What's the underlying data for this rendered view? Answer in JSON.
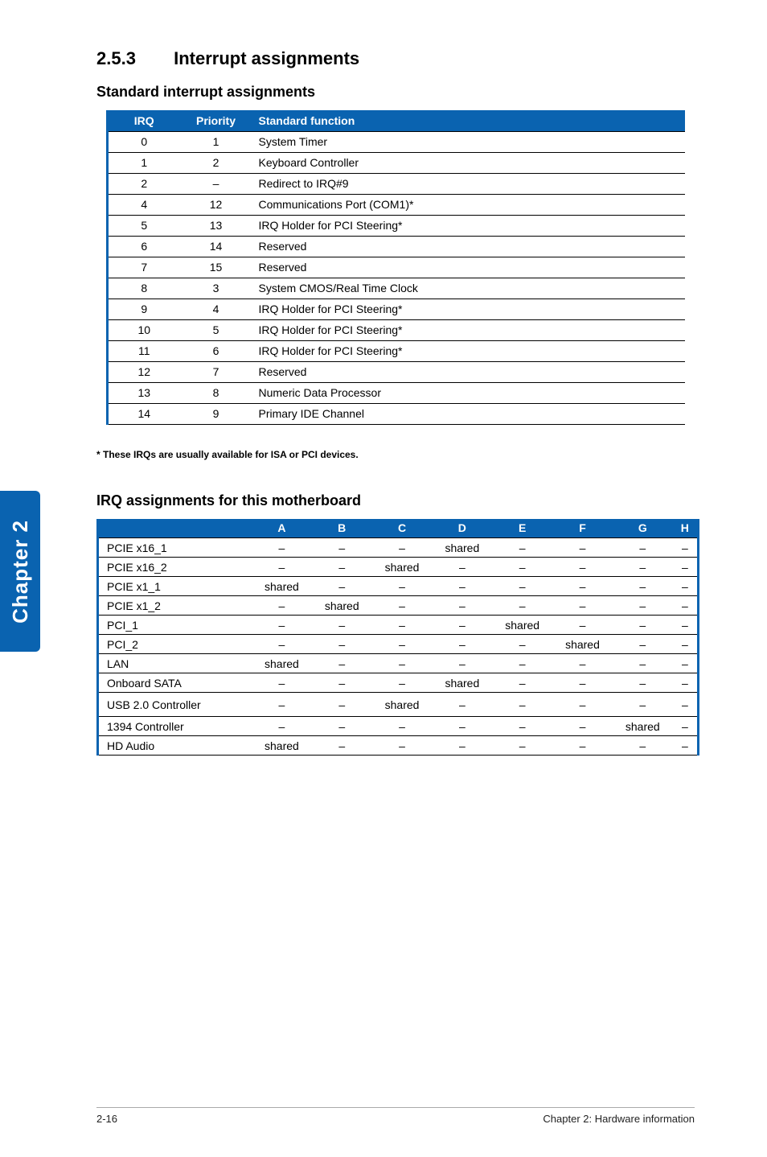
{
  "section": {
    "number": "2.5.3",
    "title": "Interrupt assignments"
  },
  "sub1": "Standard interrupt assignments",
  "table1": {
    "headers": [
      "IRQ",
      "Priority",
      "Standard function"
    ],
    "rows": [
      {
        "irq": "0",
        "pri": "1",
        "fn": "System Timer"
      },
      {
        "irq": "1",
        "pri": "2",
        "fn": "Keyboard Controller"
      },
      {
        "irq": "2",
        "pri": "–",
        "fn": "Redirect to IRQ#9"
      },
      {
        "irq": "4",
        "pri": "12",
        "fn": "Communications Port (COM1)*"
      },
      {
        "irq": "5",
        "pri": "13",
        "fn": "IRQ Holder for PCI Steering*"
      },
      {
        "irq": "6",
        "pri": "14",
        "fn": "Reserved"
      },
      {
        "irq": "7",
        "pri": "15",
        "fn": "Reserved"
      },
      {
        "irq": "8",
        "pri": "3",
        "fn": "System CMOS/Real Time Clock"
      },
      {
        "irq": "9",
        "pri": "4",
        "fn": "IRQ Holder for PCI Steering*"
      },
      {
        "irq": "10",
        "pri": "5",
        "fn": "IRQ Holder for PCI Steering*"
      },
      {
        "irq": "11",
        "pri": "6",
        "fn": "IRQ Holder for PCI Steering*"
      },
      {
        "irq": "12",
        "pri": "7",
        "fn": "Reserved"
      },
      {
        "irq": "13",
        "pri": "8",
        "fn": "Numeric Data Processor"
      },
      {
        "irq": "14",
        "pri": "9",
        "fn": "Primary IDE Channel"
      }
    ]
  },
  "footnote": "* These IRQs are usually available for ISA or PCI devices.",
  "sub2": "IRQ assignments for this motherboard",
  "table2": {
    "headers": [
      "",
      "A",
      "B",
      "C",
      "D",
      "E",
      "F",
      "G",
      "H"
    ],
    "rows": [
      {
        "label": "PCIE x16_1",
        "cells": [
          "–",
          "–",
          "–",
          "shared",
          "–",
          "–",
          "–",
          "–"
        ]
      },
      {
        "label": "PCIE x16_2",
        "cells": [
          "–",
          "–",
          "shared",
          "–",
          "–",
          "–",
          "–",
          "–"
        ]
      },
      {
        "label": "PCIE x1_1",
        "cells": [
          "shared",
          "–",
          "–",
          "–",
          "–",
          "–",
          "–",
          "–"
        ]
      },
      {
        "label": "PCIE x1_2",
        "cells": [
          "–",
          "shared",
          "–",
          "–",
          "–",
          "–",
          "–",
          "–"
        ]
      },
      {
        "label": "PCI_1",
        "cells": [
          "–",
          "–",
          "–",
          "–",
          "shared",
          "–",
          "–",
          "–"
        ]
      },
      {
        "label": "PCI_2",
        "cells": [
          "–",
          "–",
          "–",
          "–",
          "–",
          "shared",
          "–",
          "–"
        ]
      },
      {
        "label": "LAN",
        "cells": [
          "shared",
          "–",
          "–",
          "–",
          "–",
          "–",
          "–",
          "–"
        ]
      },
      {
        "label": "Onboard SATA",
        "cells": [
          "–",
          "–",
          "–",
          "shared",
          "–",
          "–",
          "–",
          "–"
        ]
      },
      {
        "label": "USB 2.0 Controller",
        "cells": [
          "–",
          "–",
          "shared",
          "–",
          "–",
          "–",
          "–",
          "–"
        ],
        "tall": true
      },
      {
        "label": "1394 Controller",
        "cells": [
          "–",
          "–",
          "–",
          "–",
          "–",
          "–",
          "shared",
          "–"
        ]
      },
      {
        "label": "HD Audio",
        "cells": [
          "shared",
          "–",
          "–",
          "–",
          "–",
          "–",
          "–",
          "–"
        ]
      }
    ]
  },
  "tab": "Chapter 2",
  "footer": {
    "left": "2-16",
    "right": "Chapter 2: Hardware information"
  }
}
